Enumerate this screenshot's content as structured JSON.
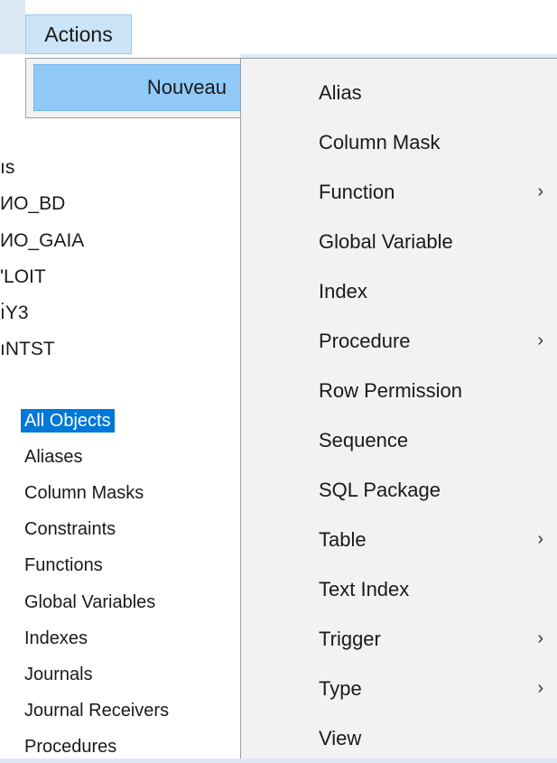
{
  "menubar": {
    "actions_label": "Actions"
  },
  "context_menu": {
    "nouveau_label": "Nouveau",
    "nouveau_arrow": "›"
  },
  "submenu": {
    "items": [
      {
        "label": "Alias",
        "has_submenu": false
      },
      {
        "label": "Column Mask",
        "has_submenu": false
      },
      {
        "label": "Function",
        "has_submenu": true
      },
      {
        "label": "Global Variable",
        "has_submenu": false
      },
      {
        "label": "Index",
        "has_submenu": false
      },
      {
        "label": "Procedure",
        "has_submenu": true
      },
      {
        "label": "Row Permission",
        "has_submenu": false
      },
      {
        "label": "Sequence",
        "has_submenu": false
      },
      {
        "label": "SQL Package",
        "has_submenu": false
      },
      {
        "label": "Table",
        "has_submenu": true
      },
      {
        "label": "Text Index",
        "has_submenu": false
      },
      {
        "label": "Trigger",
        "has_submenu": true
      },
      {
        "label": "Type",
        "has_submenu": true
      },
      {
        "label": "View",
        "has_submenu": false
      }
    ],
    "arrow_glyph": "›"
  },
  "tree": {
    "schemas": [
      "ıs",
      "ИO_BD",
      "ИO_GAIA",
      "'LOIT",
      "ı̇Y3",
      "ıNTST"
    ],
    "object_types": [
      "All Objects",
      "Aliases",
      "Column Masks",
      "Constraints",
      "Functions",
      "Global Variables",
      "Indexes",
      "Journals",
      "Journal Receivers",
      "Procedures"
    ]
  },
  "colors": {
    "selection": "#0078d7",
    "hover_highlight": "#91c9f7",
    "menu_background": "#f2f2f2",
    "menubar_active": "#cce4f7"
  }
}
